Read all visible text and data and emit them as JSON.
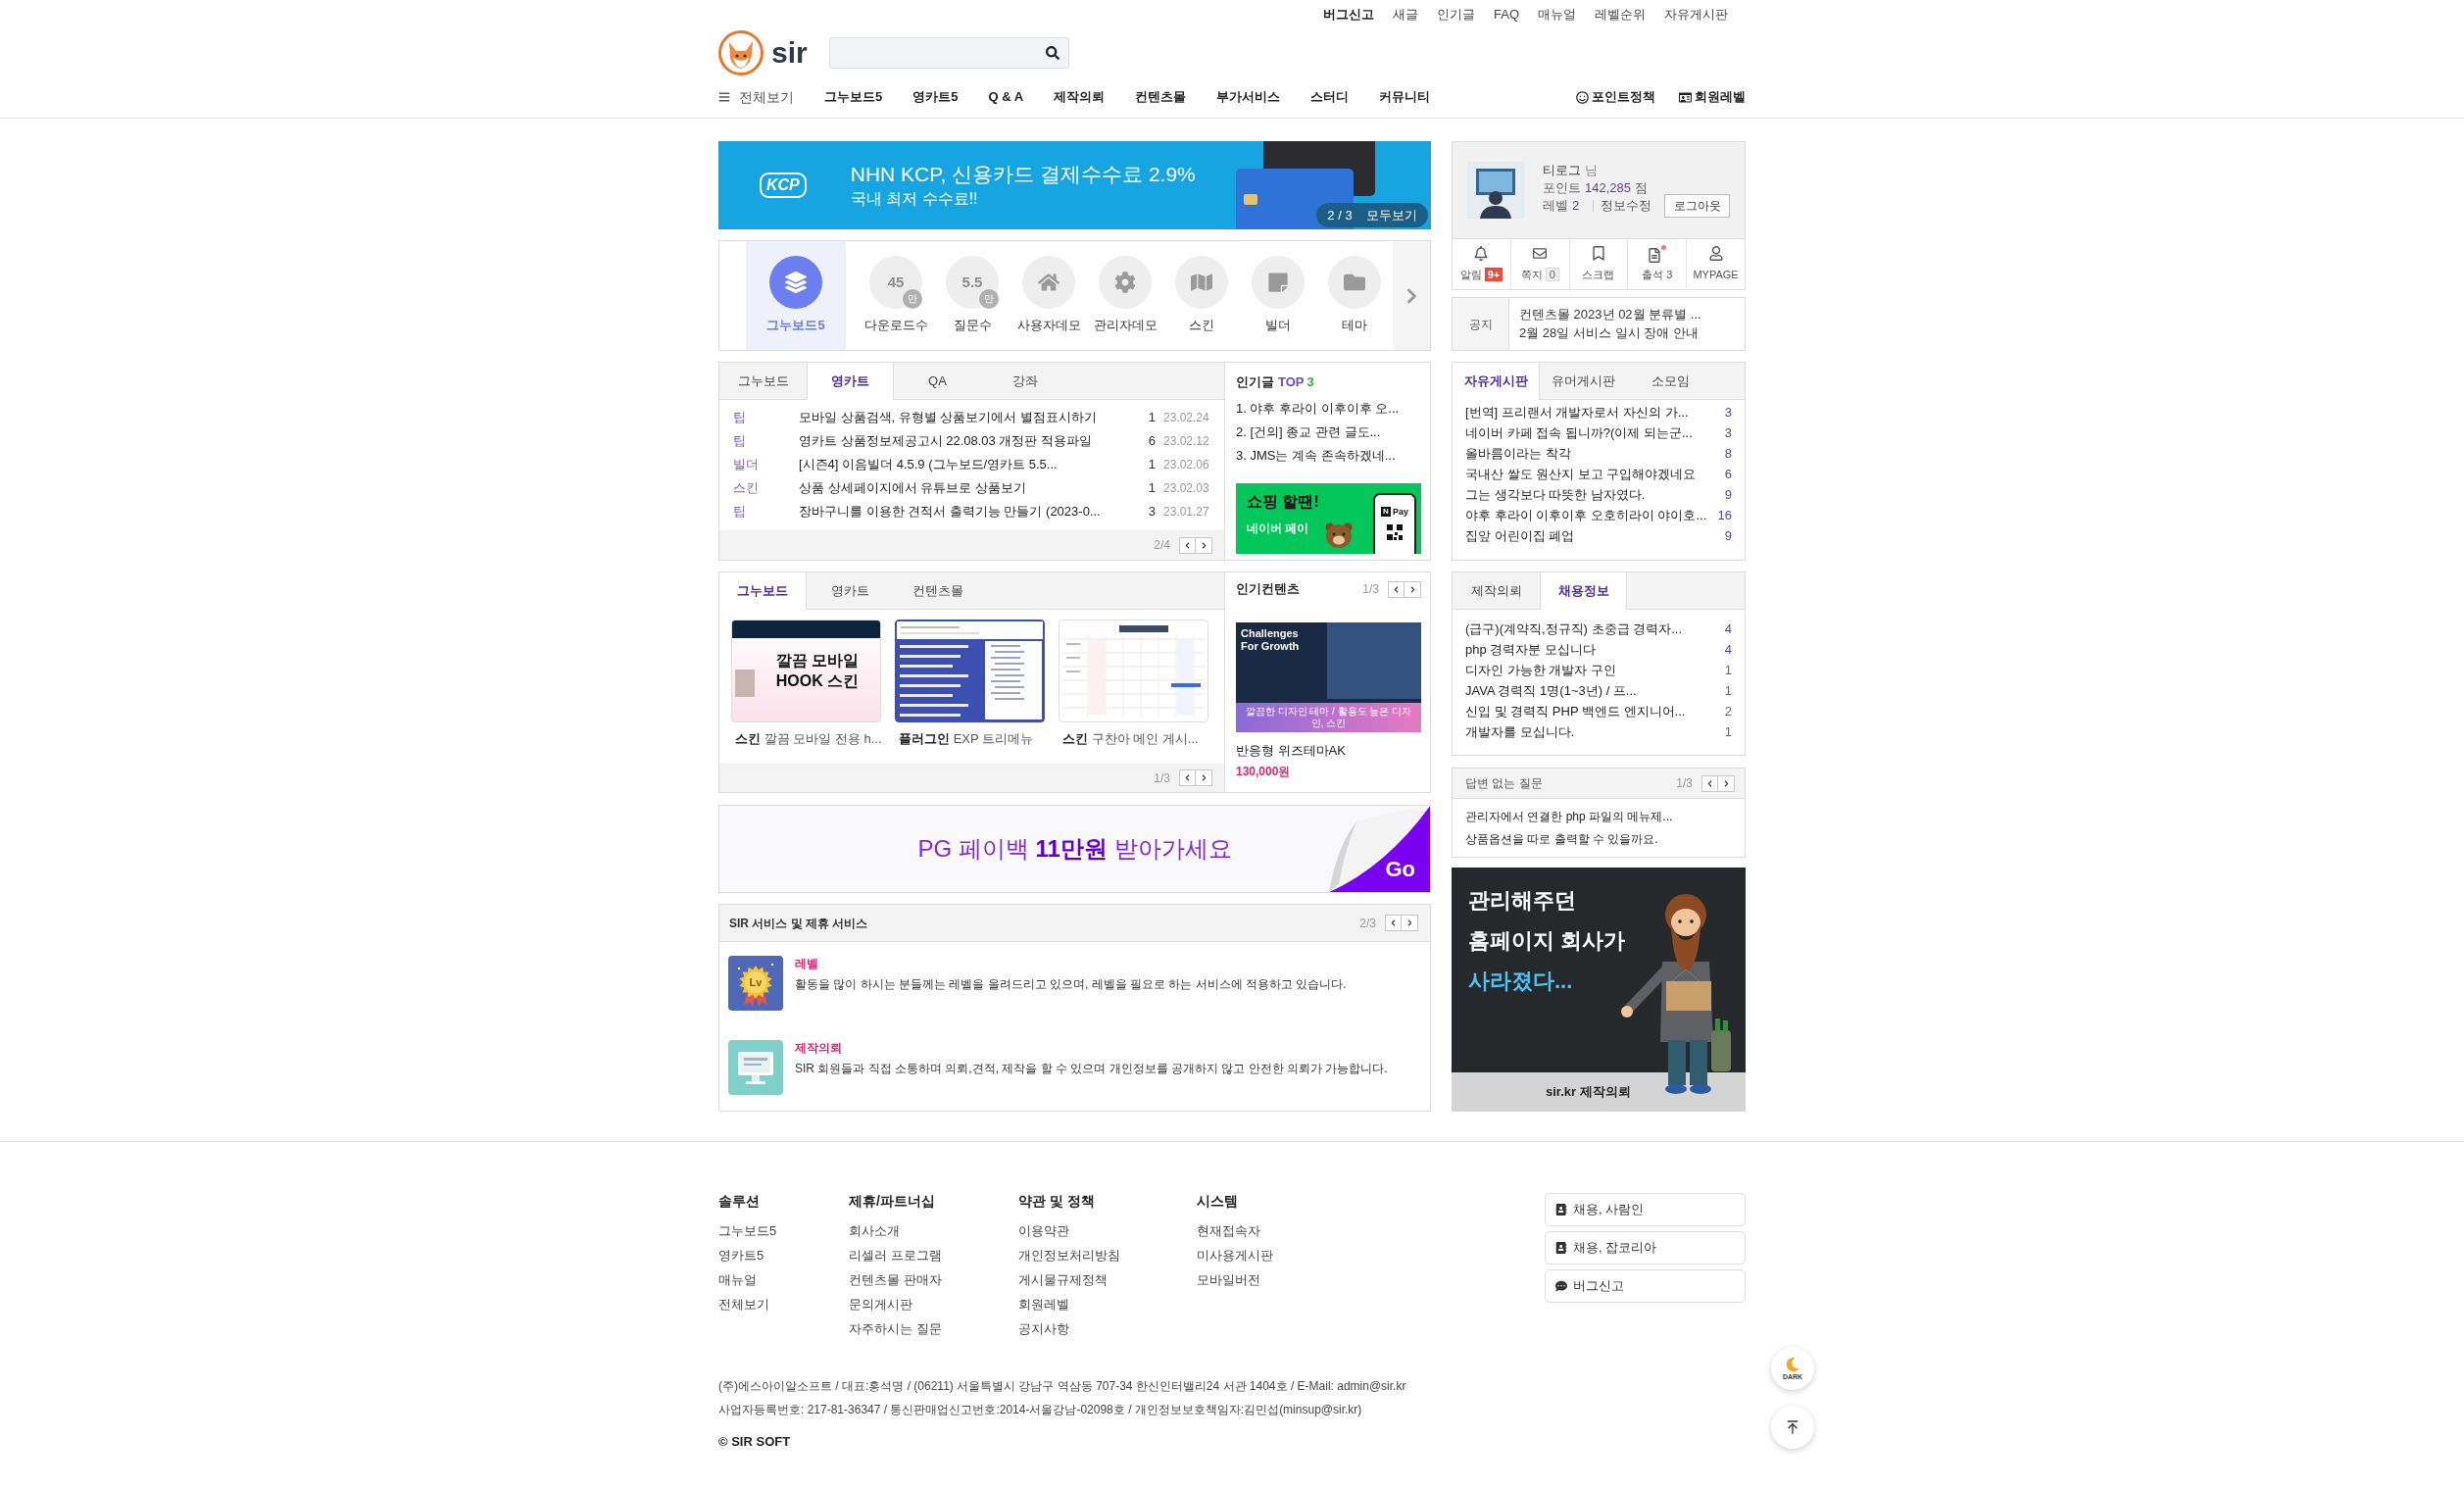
{
  "top_links": [
    {
      "label": "버그신고",
      "emphasized": true
    },
    {
      "label": "새글",
      "emphasized": false
    },
    {
      "label": "인기글",
      "emphasized": false
    },
    {
      "label": "FAQ",
      "emphasized": false
    },
    {
      "label": "매뉴얼",
      "emphasized": false
    },
    {
      "label": "레벨순위",
      "emphasized": false
    },
    {
      "label": "자유게시판",
      "emphasized": false
    }
  ],
  "logo": {
    "text": "sir"
  },
  "nav": {
    "menu_label": "전체보기",
    "items": [
      "그누보드5",
      "영카트5",
      "Q & A",
      "제작의뢰",
      "컨텐츠몰",
      "부가서비스",
      "스터디",
      "커뮤니티"
    ],
    "right_links": [
      "포인트정책",
      "회원레벨"
    ]
  },
  "banner": {
    "brand": "KCP",
    "title": "NHN KCP, 신용카드 결제수수료 2.9%",
    "subtitle": "국내 최저 수수료!!",
    "pager": "2 / 3",
    "view_all": "모두보기"
  },
  "quick_menu": {
    "items": [
      {
        "kind": "icon",
        "label": "그누보드5",
        "selected": true
      },
      {
        "kind": "count",
        "value": "45",
        "unit": "만",
        "label": "다운로드수",
        "selected": false
      },
      {
        "kind": "count",
        "value": "5.5",
        "unit": "만",
        "label": "질문수",
        "selected": false
      },
      {
        "kind": "icon",
        "label": "사용자데모",
        "selected": false
      },
      {
        "kind": "icon",
        "label": "관리자데모",
        "selected": false
      },
      {
        "kind": "icon",
        "label": "스킨",
        "selected": false
      },
      {
        "kind": "icon",
        "label": "빌더",
        "selected": false
      },
      {
        "kind": "icon",
        "label": "테마",
        "selected": false
      }
    ]
  },
  "board": {
    "tabs": [
      {
        "label": "그누보드",
        "selected": false
      },
      {
        "label": "영카트",
        "selected": true
      },
      {
        "label": "QA",
        "selected": false
      },
      {
        "label": "강좌",
        "selected": false
      }
    ],
    "rows": [
      {
        "category": "팁",
        "title": "모바일 상품검색, 유형별 상품보기에서 별점표시하기",
        "comments": "1",
        "date": "23.02.24"
      },
      {
        "category": "팁",
        "title": "영카트 상품정보제공고시 22.08.03 개정판 적용파일",
        "comments": "6",
        "date": "23.02.12"
      },
      {
        "category": "빌더",
        "title": "[시즌4] 이음빌더 4.5.9 (그누보드/영카트 5.5...",
        "comments": "1",
        "date": "23.02.06"
      },
      {
        "category": "스킨",
        "title": "상품 상세페이지에서 유튜브로 상품보기",
        "comments": "1",
        "date": "23.02.03"
      },
      {
        "category": "팁",
        "title": "장바구니를 이용한 견적서 출력기능 만들기 (2023-0...",
        "comments": "3",
        "date": "23.01.27"
      }
    ],
    "pager": "2/4"
  },
  "popular_posts": {
    "title": "인기글",
    "highlight": "TOP",
    "count": "3",
    "items": [
      "1. 야후 후라이 이후이후 오...",
      "2. [건의] 종교 관련 글도...",
      "3. JMS는 계속 존속하겠네..."
    ],
    "ad": {
      "headline": "쇼핑 할땐!",
      "subline": "네이버 페이",
      "pay_mark": "N",
      "pay_label": "Pay"
    }
  },
  "showcase": {
    "tabs": [
      {
        "label": "그누보드",
        "selected": true
      },
      {
        "label": "영카트",
        "selected": false
      },
      {
        "label": "컨텐츠몰",
        "selected": false
      }
    ],
    "cards": [
      {
        "kind": "banner",
        "category": "스킨",
        "title": "깔끔 모바일 전용 h...",
        "thumb_text": [
          "깔끔 모바일",
          "HOOK 스킨"
        ]
      },
      {
        "kind": "list",
        "category": "플러그인",
        "title": "EXP 트리메뉴"
      },
      {
        "kind": "calendar",
        "category": "스킨",
        "title": "구찬아 메인 게시..."
      }
    ],
    "pager": "1/3"
  },
  "popular_contents": {
    "title": "인기컨텐츠",
    "pager": "1/3",
    "image_heading": "Challenges For Growth",
    "image_caption": "깔끔한 디자인 테마 / 활용도 높은 디자인, 스킨",
    "product": "반응형 위즈테마AK",
    "price": "130,000원"
  },
  "payback_banner": {
    "text": "PG 페이백 **11만원** 받아가세요",
    "action": "Go"
  },
  "services": {
    "title": "SIR 서비스 및 제휴 서비스",
    "pager": "2/3",
    "items": [
      {
        "name": "레벨",
        "description": "활동을 많이 하시는 분들께는 레벨을 올려드리고 있으며, 레벨을 필요로 하는 서비스에 적용하고 있습니다.",
        "icon_text": "Lv"
      },
      {
        "name": "제작의뢰",
        "description": "SIR 회원들과 직접 소통하며 의뢰,견적, 제작을 할 수 있으며 개인정보를 공개하지 않고 안전한 의뢰가 가능합니다."
      }
    ]
  },
  "profile": {
    "name": "티로그",
    "honorific": "님",
    "points_label": "포인트",
    "points": "142,285",
    "points_unit": "점",
    "level_label": "레벨",
    "level": "2",
    "edit_link": "정보수정",
    "logout": "로그아웃",
    "shortcuts": [
      {
        "label": "알림",
        "badge": {
          "kind": "alert",
          "text": "9+"
        },
        "new": false
      },
      {
        "label": "쪽지",
        "badge": {
          "kind": "box",
          "text": "0"
        },
        "new": false
      },
      {
        "label": "스크랩",
        "new": false
      },
      {
        "label": "출석",
        "badge": {
          "kind": "plain",
          "text": "3"
        },
        "new": true
      },
      {
        "label": "MYPAGE",
        "new": false
      }
    ]
  },
  "notice": {
    "label": "공지",
    "items": [
      "컨텐츠몰 2023년 02월 분류별 ...",
      "2월 28일 서비스 일시 장애 안내"
    ]
  },
  "free_board": {
    "tabs": [
      {
        "label": "자유게시판",
        "selected": true
      },
      {
        "label": "유머게시판",
        "selected": false
      },
      {
        "label": "소모임",
        "selected": false
      }
    ],
    "rows": [
      {
        "title": "[번역] 프리랜서 개발자로서 자신의 가...",
        "count": "3",
        "highlight": true
      },
      {
        "title": "네이버 카페 접속 됩니까?(이제 되는군...",
        "count": "3",
        "highlight": true
      },
      {
        "title": "올바름이라는 착각",
        "count": "8",
        "highlight": true
      },
      {
        "title": "국내산 쌀도 원산지 보고 구입해야겠네요",
        "count": "6",
        "highlight": true
      },
      {
        "title": "그는 생각보다 따뜻한 남자였다.",
        "count": "9",
        "highlight": true
      },
      {
        "title": "야후 후라이 이후이후 오호히라이 야이호...",
        "count": "16",
        "highlight": true
      },
      {
        "title": "집앞 어린이집 폐업",
        "count": "9",
        "highlight": true
      }
    ]
  },
  "jobs_board": {
    "tabs": [
      {
        "label": "제작의뢰",
        "selected": false
      },
      {
        "label": "채용정보",
        "selected": true
      }
    ],
    "rows": [
      {
        "title": "(급구)(계약직,정규직) 초중급 경력자...",
        "count": "4",
        "highlight": true
      },
      {
        "title": "php 경력자분 모십니다",
        "count": "4",
        "highlight": true
      },
      {
        "title": "디자인 가능한 개발자 구인",
        "count": "1",
        "highlight": false
      },
      {
        "title": "JAVA 경력직 1명(1~3년) / 프...",
        "count": "1",
        "highlight": false
      },
      {
        "title": "신입 및 경력직 PHP 백엔드 엔지니어...",
        "count": "2",
        "highlight": false
      },
      {
        "title": "개발자를 모십니다.",
        "count": "1",
        "highlight": false
      }
    ]
  },
  "unanswered": {
    "title": "답변 없는 질문",
    "pager": "1/3",
    "items": [
      "관리자에서 연결한 php 파일의 메뉴제...",
      "상품옵션을 따로 출력할 수 있을까요."
    ]
  },
  "side_ad": {
    "lines": [
      {
        "text": "관리해주던",
        "highlight": false
      },
      {
        "text": "홈페이지 회사가",
        "highlight": false
      },
      {
        "text": "사라졌다...",
        "highlight": true
      }
    ],
    "footer": "sir.kr 제작의뢰"
  },
  "footer": {
    "columns": [
      {
        "title": "솔루션",
        "links": [
          "그누보드5",
          "영카트5",
          "매뉴얼",
          "전체보기"
        ]
      },
      {
        "title": "제휴/파트너십",
        "links": [
          "회사소개",
          "리셀러 프로그램",
          "컨텐츠몰 판매자",
          "문의게시판",
          "자주하시는 질문"
        ]
      },
      {
        "title": "약관 및 정책",
        "links": [
          "이용약관",
          "개인정보처리방침",
          "게시물규제정책",
          "회원레벨",
          "공지사항"
        ]
      },
      {
        "title": "시스템",
        "links": [
          "현재접속자",
          "미사용게시판",
          "모바일버전"
        ]
      }
    ],
    "side_links": [
      "채용, 사람인",
      "채용, 잡코리아",
      "버그신고"
    ],
    "company_lines": [
      "(주)에스아이알소프트 / 대표:홍석명 / (06211) 서울특별시 강남구 역삼동 707-34 한신인터밸리24 서관 1404호 / E-Mail: admin@sir.kr",
      "사업자등록번호: 217-81-36347 / 통신판매업신고번호:2014-서울강남-02098호 / 개인정보보호책임자:김민섭(minsup@sir.kr)"
    ],
    "copyright": "© SIR SOFT"
  },
  "floating": {
    "dark_label": "DARK"
  }
}
